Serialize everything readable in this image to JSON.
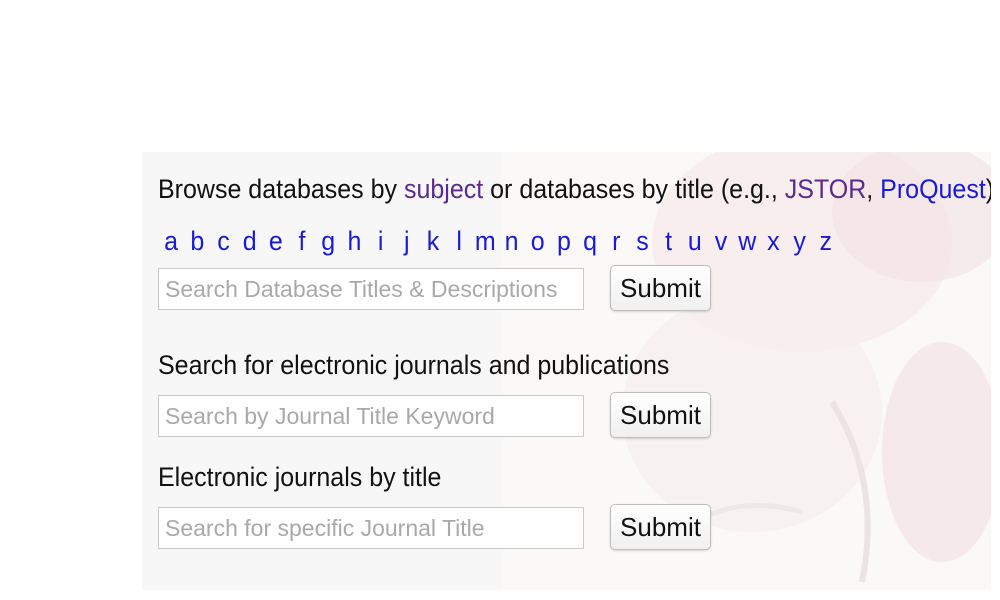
{
  "databases": {
    "browse_prefix": "Browse databases by ",
    "subject_link": "subject",
    "browse_mid": " or databases by title (e.g., ",
    "jstor_link": "JSTOR",
    "comma": ", ",
    "proquest_link": "ProQuest",
    "browse_suffix": ")",
    "alphabet": [
      "a",
      "b",
      "c",
      "d",
      "e",
      "f",
      "g",
      "h",
      "i",
      "j",
      "k",
      "l",
      "m",
      "n",
      "o",
      "p",
      "q",
      "r",
      "s",
      "t",
      "u",
      "v",
      "w",
      "x",
      "y",
      "z"
    ],
    "search_placeholder": "Search Database Titles & Descriptions",
    "submit_label": "Submit"
  },
  "ejournals": {
    "heading": "Search for electronic journals and publications",
    "search_placeholder": "Search by Journal Title Keyword",
    "submit_label": "Submit"
  },
  "ejournals_title": {
    "heading": "Electronic journals by title",
    "search_placeholder": "Search for specific Journal Title",
    "submit_label": "Submit"
  },
  "colors": {
    "visited_link": "#5a2a8c",
    "link": "#1a1ad6",
    "panel_bg": "#f7f7f7"
  }
}
